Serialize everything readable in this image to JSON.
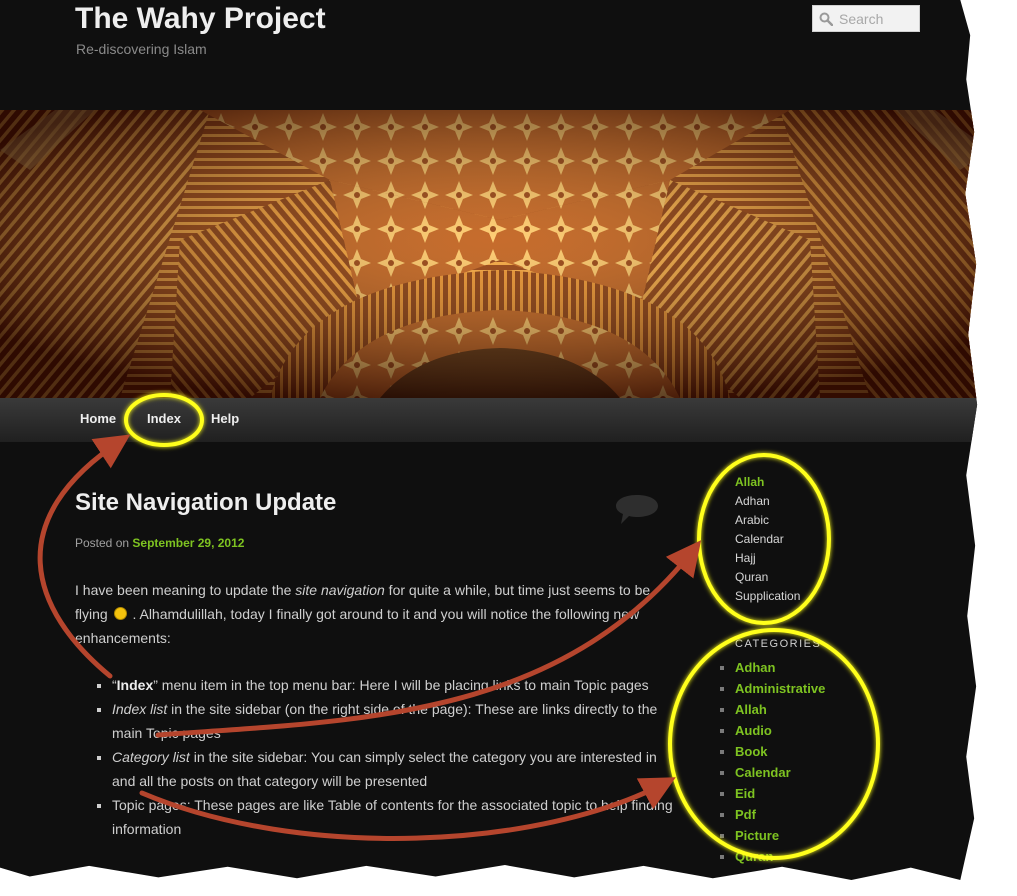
{
  "site": {
    "title": "The Wahy Project",
    "description": "Re-discovering Islam"
  },
  "search": {
    "placeholder": "Search"
  },
  "menu": {
    "home": "Home",
    "index": "Index",
    "help": "Help"
  },
  "post": {
    "title": "Site Navigation Update",
    "posted_on": "Posted on",
    "date": "September 29, 2012",
    "p1_a": "I have been meaning to update the ",
    "p1_em": "site navigation",
    "p1_b": " for quite a while, but time just seems to be flying ",
    "p1_c": " . Alhamdulillah, today I finally got around to it and you will notice the following new enhancements:",
    "bullets": [
      {
        "strong": "Index",
        "pre": "“",
        "post": "” menu item in the top menu bar: Here I will be placing links to main Topic pages"
      },
      {
        "em": "Index list",
        "post": " in the site sidebar (on the right side of the page): These are links directly to the main Topic pages"
      },
      {
        "em": "Category list",
        "post": " in the site sidebar: You can simply select the category you are interested in and all the posts on that category will be presented"
      },
      {
        "post": "Topic pages: These pages are like Table of contents for the associated topic to help finding information"
      }
    ]
  },
  "sidebar": {
    "index": [
      "Allah",
      "Adhan",
      "Arabic",
      "Calendar",
      "Hajj",
      "Quran",
      "Supplication"
    ],
    "categories_heading": "CATEGORIES",
    "categories": [
      "Adhan",
      "Administrative",
      "Allah",
      "Audio",
      "Book",
      "Calendar",
      "Eid",
      "Pdf",
      "Picture",
      "Quran"
    ]
  },
  "colors": {
    "page_bg": "#0f0f0f",
    "link_green": "#7ec321",
    "annotation_yellow": "#ffff1a",
    "annotation_arrow": "#b5452d"
  },
  "icons": [
    "search-icon",
    "comment-bubble-icon",
    "wink-smiley-icon"
  ]
}
